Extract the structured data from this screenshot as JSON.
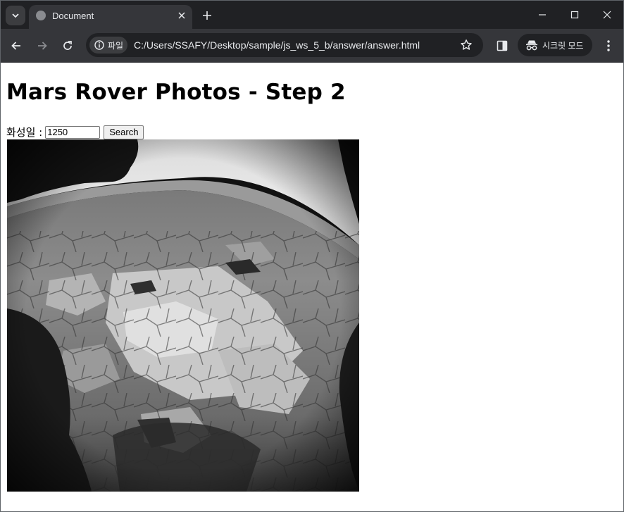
{
  "browser": {
    "tab_title": "Document",
    "site_chip_label": "파일",
    "url": "C:/Users/SSAFY/Desktop/sample/js_ws_5_b/answer/answer.html",
    "incognito_label": "시크릿 모드"
  },
  "page": {
    "title": "Mars Rover Photos - Step 2",
    "sol_label": "화성일 :",
    "sol_value": "1250",
    "search_button": "Search"
  },
  "photo": {
    "subject": "Mars surface rocky terrain (grayscale rover camera)"
  },
  "colors": {
    "tabstrip_bg": "#202124",
    "toolbar_bg": "#35363a",
    "page_bg": "#ffffff"
  }
}
